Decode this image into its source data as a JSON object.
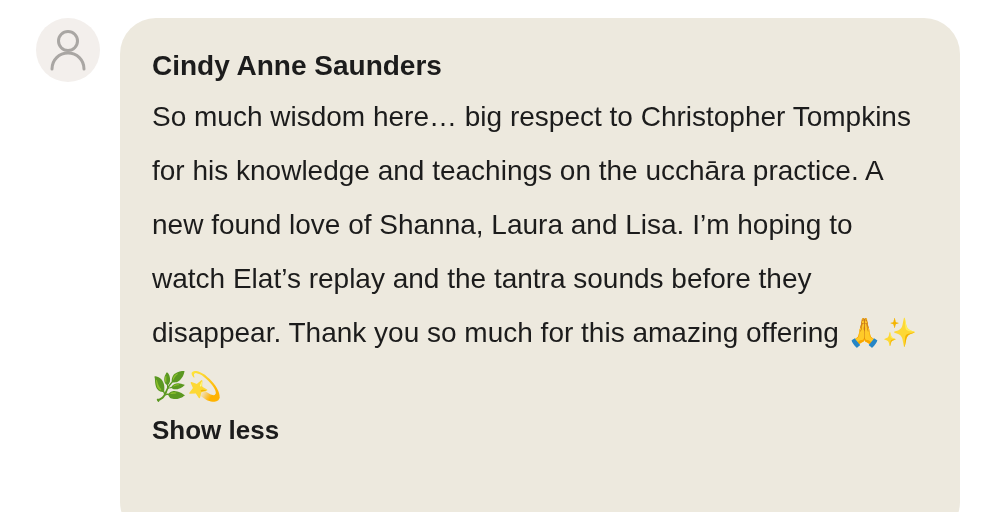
{
  "comment": {
    "author": "Cindy Anne Saunders",
    "body": "So much wisdom here… big respect to Christopher Tompkins for his knowledge and teachings on the ucchāra practice. A new found love of Shanna, Laura and Lisa. I’m hoping to watch Elat’s replay and the tantra sounds before they disappear. Thank you so much for this amazing offering 🙏✨🌿💫",
    "toggle": "Show less"
  }
}
